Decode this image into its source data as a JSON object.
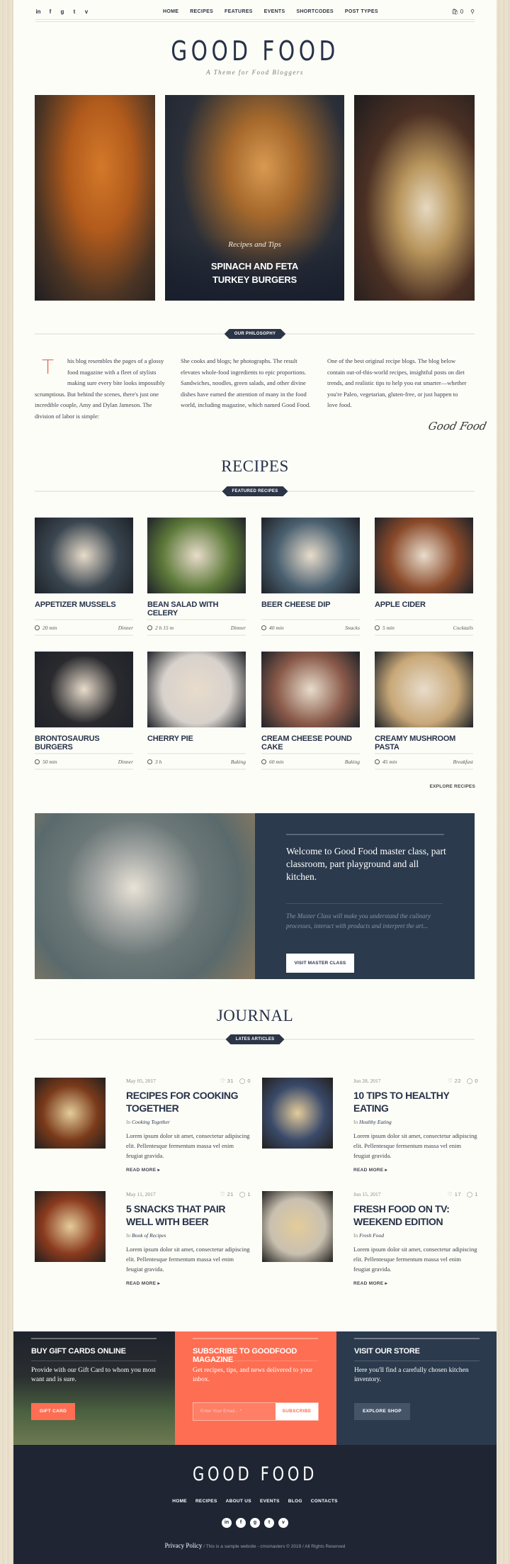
{
  "topbar": {
    "social_icons": [
      "linkedin-icon",
      "facebook-icon",
      "google-plus-icon",
      "twitter-icon",
      "vimeo-icon"
    ],
    "social_glyphs": [
      "in",
      "f",
      "g",
      "t",
      "v"
    ],
    "nav": [
      "HOME",
      "RECIPES",
      "FEATURES",
      "EVENTS",
      "SHORTCODES",
      "POST TYPES"
    ],
    "cart_count": "0"
  },
  "header": {
    "logo": "GOOD FOOD",
    "tagline": "A Theme for Food Bloggers"
  },
  "hero": {
    "category": "Recipes and Tips",
    "title_line1": "SPINACH AND FETA",
    "title_line2": "TURKEY BURGERS"
  },
  "philosophy": {
    "badge": "OUR PHILOSOPHY",
    "dropcap": "T",
    "col1": "his blog resembles the pages of a glossy food magazine with a fleet of stylists making sure every bite looks impossibly scrumptious. But behind the scenes, there's just one incredible couple, Amy and Dylan Jameson. The division of labor is simple:",
    "col2": "She cooks and blogs; he photographs. The result elevates whole-food ingredients to epic proportions. Sandwiches, noodles, green salads, and other divine dishes have earned the attention of many in the food world, including magazine, which named Good Food.",
    "col3": "One of the best original recipe blogs. The blog below contain out-of-this-world recipes, insightful posts on diet trends, and realistic tips to help you eat smarter—whether you're Paleo, vegetarian, gluten-free, or just happen to love food.",
    "signature": "Good Food"
  },
  "recipes": {
    "heading": "RECIPES",
    "badge": "FEATURED RECIPES",
    "items": [
      {
        "title": "APPETIZER MUSSELS",
        "time": "20 min",
        "category": "Dinner",
        "color": "#3a4650"
      },
      {
        "title": "BEAN SALAD WITH CELERY",
        "time": "2 h 15 m",
        "category": "Dinner",
        "color": "#5e7a3a"
      },
      {
        "title": "BEER CHEESE DIP",
        "time": "40 min",
        "category": "Snacks",
        "color": "#4a6070"
      },
      {
        "title": "APPLE CIDER",
        "time": "5 min",
        "category": "Cocktails",
        "color": "#8a4a2a"
      },
      {
        "title": "BRONTOSAURUS BURGERS",
        "time": "50 min",
        "category": "Dinner",
        "color": "#2a2a2e"
      },
      {
        "title": "CHERRY PIE",
        "time": "3 h",
        "category": "Baking",
        "color": "#d8d2cc"
      },
      {
        "title": "CREAM CHEESE POUND CAKE",
        "time": "60 min",
        "category": "Baking",
        "color": "#8a5a4a"
      },
      {
        "title": "CREAMY MUSHROOM PASTA",
        "time": "45 min",
        "category": "Breakfast",
        "color": "#c8a878"
      }
    ],
    "explore": "EXPLORE RECIPES"
  },
  "masterclass": {
    "title": "Welcome to Good Food master class, part classroom, part playground and all kitchen.",
    "text": "The Master Class will make you understand the culinary processes, interact with products and interpret the art...",
    "button": "VISIT MASTER CLASS"
  },
  "journal": {
    "heading": "JOURNAL",
    "badge": "LATES ARTICLES",
    "in_label": "In",
    "read_more": "READ MORE",
    "items": [
      {
        "date": "May 05, 2017",
        "likes": "31",
        "comments": "0",
        "title": "RECIPES FOR COOKING TOGETHER",
        "category": "Cooking Together",
        "excerpt": "Lorem ipsum dolor sit amet, consectetur adipiscing elit. Pellentesque fermentum massa vel enim feugiat gravida.",
        "color": "#7a3a1a"
      },
      {
        "date": "Jun 28, 2017",
        "likes": "22",
        "comments": "0",
        "title": "10 TIPS TO HEALTHY EATING",
        "category": "Healthy Eating",
        "excerpt": "Lorem ipsum dolor sit amet, consectetur adipiscing elit. Pellentesque fermentum massa vel enim feugiat gravida.",
        "color": "#3a4a6a"
      },
      {
        "date": "May 11, 2017",
        "likes": "21",
        "comments": "1",
        "title": "5 SNACKS THAT PAIR WELL WITH BEER",
        "category": "Book of Recipes",
        "excerpt": "Lorem ipsum dolor sit amet, consectetur adipiscing elit. Pellentesque fermentum massa vel enim feugiat gravida.",
        "color": "#8a3a1e"
      },
      {
        "date": "Jun 15, 2017",
        "likes": "17",
        "comments": "1",
        "title": "FRESH FOOD ON TV: WEEKEND EDITION",
        "category": "Fresh Food",
        "excerpt": "Lorem ipsum dolor sit amet, consectetur adipiscing elit. Pellentesque fermentum massa vel enim feugiat gravida.",
        "color": "#c8c0b0"
      }
    ]
  },
  "promo": {
    "gift": {
      "title": "BUY GIFT CARDS ONLINE",
      "text": "Provide with our Gift Card to whom you most want and is sure.",
      "button": "GIFT CARD"
    },
    "subscribe": {
      "title": "SUBSCRIBE TO GOODFOOD MAGAZINE",
      "text": "Get recipes, tips, and news delivered to your inbox.",
      "placeholder": "Enter Your Email... *",
      "button": "SUBSCRIBE"
    },
    "store": {
      "title": "VISIT OUR STORE",
      "text": "Here you'll find a carefully chosen kitchen inventory.",
      "button": "EXPLORE SHOP"
    }
  },
  "footer": {
    "logo": "GOOD FOOD",
    "nav": [
      "HOME",
      "RECIPES",
      "ABOUT US",
      "EVENTS",
      "BLOG",
      "CONTACTS"
    ],
    "privacy": "Privacy Policy",
    "copyright": " / This is a sample website - cmsmasters © 2019 / All Rights Reserved"
  },
  "colors": {
    "accent": "#fe6e52",
    "navy": "#2b3a4d",
    "dark": "#1f2533",
    "background": "#fdfdf7"
  }
}
